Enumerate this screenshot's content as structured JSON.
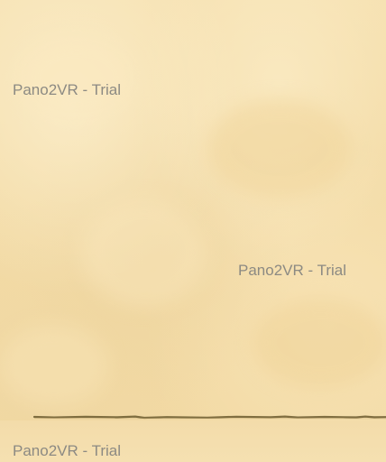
{
  "viewer": {
    "watermark_text": "Pano2VR - Trial",
    "watermarks": [
      "Pano2VR - Trial",
      "Pano2VR - Trial",
      "Pano2VR - Trial"
    ],
    "colors": {
      "parchment": "#f4dca8",
      "watermark": "#8c8a83",
      "seam": "#6b5a2e"
    }
  }
}
